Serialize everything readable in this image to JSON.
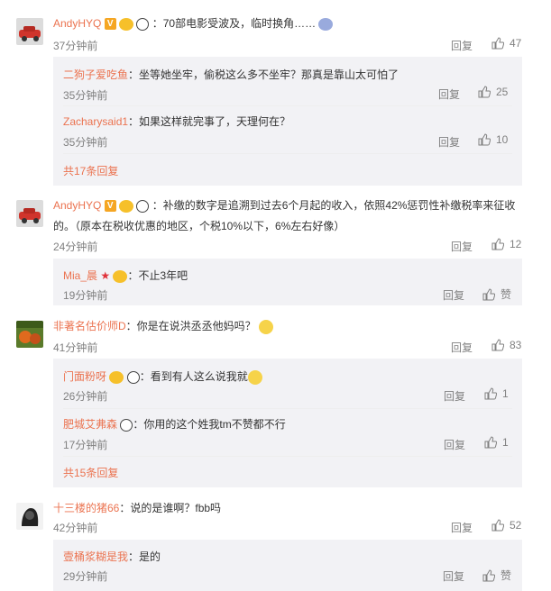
{
  "colors": {
    "username": "#eb7350",
    "subbox": "#f2f2f5",
    "meta": "#808080"
  },
  "comments": [
    {
      "user": "AndyHYQ",
      "text": "：70部电影受波及，临时换角……",
      "time": "37分钟前",
      "reply": "回复",
      "likes": "47",
      "subs": [
        {
          "user": "二狗子爱吃鱼",
          "text": "：坐等她坐牢，偷税这么多不坐牢？那真是靠山太可怕了",
          "time": "35分钟前",
          "reply": "回复",
          "likes": "25"
        },
        {
          "user": "Zacharysaid1",
          "text": "：如果这样就完事了，天理何在？",
          "time": "35分钟前",
          "reply": "回复",
          "likes": "10"
        }
      ],
      "more": "共17条回复"
    },
    {
      "user": "AndyHYQ",
      "text_line1": "：补缴的数字是追溯到过去6个月起的收入，依照42%惩罚性补缴税率来征收",
      "text_line2": "的。（原本在税收优惠的地区，个税10%以下，6%左右好像）",
      "time": "24分钟前",
      "reply": "回复",
      "likes": "12",
      "subs": [
        {
          "user": "Mia_晨",
          "text": "：不止3年吧",
          "time": "19分钟前",
          "reply": "回复",
          "likes": "赞"
        }
      ]
    },
    {
      "user": "非著名估价师D",
      "text": "：你是在说洪丞丞他妈吗？",
      "time": "41分钟前",
      "reply": "回复",
      "likes": "83",
      "subs": [
        {
          "user": "门面粉呀",
          "text": "：看到有人这么说我就",
          "time": "26分钟前",
          "reply": "回复",
          "likes": "1"
        },
        {
          "user": "肥城艾弗森",
          "text": "：你用的这个姓我tm不赞都不行",
          "time": "17分钟前",
          "reply": "回复",
          "likes": "1"
        }
      ],
      "more": "共15条回复"
    },
    {
      "user": "十三楼的猪66",
      "text": "：说的是谁啊？fbb吗",
      "time": "42分钟前",
      "reply": "回复",
      "likes": "52",
      "subs": [
        {
          "user": "壹桶浆糊是我",
          "text": "：是的",
          "time": "29分钟前",
          "reply": "回复",
          "likes": "赞"
        }
      ]
    }
  ],
  "icons": {
    "like": "thumbs-up-icon",
    "vip": "v-badge-icon",
    "face": "emoji-icon",
    "panda": "panda-icon"
  }
}
